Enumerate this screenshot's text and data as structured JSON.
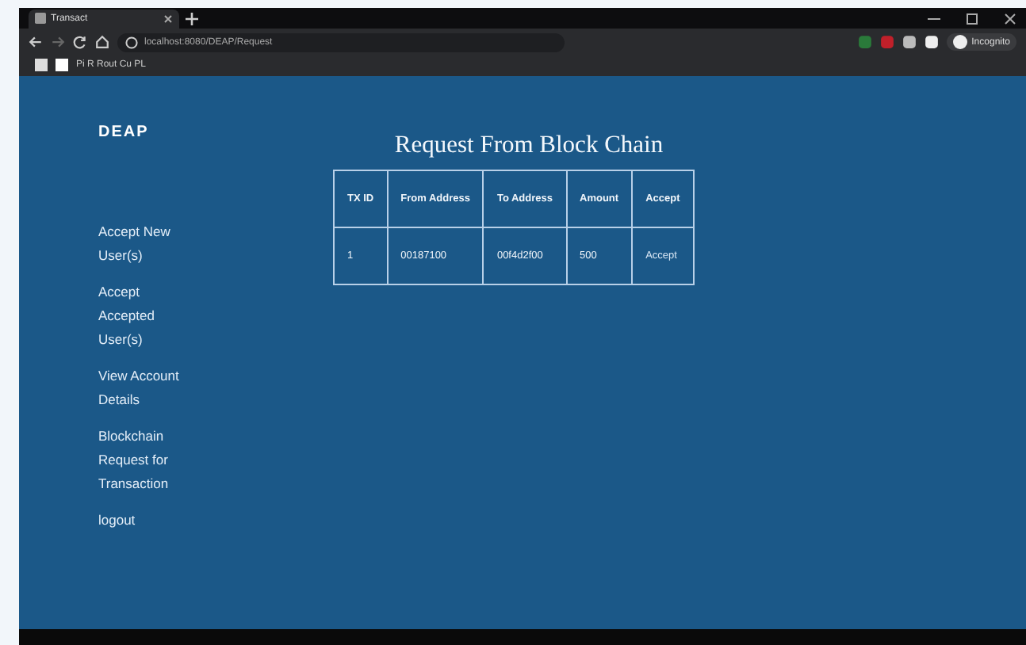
{
  "browser": {
    "tab_title": "Transact",
    "url": "localhost:8080/DEAP/Request",
    "bookmark": "Pi R Rout Cu PL",
    "profile": "Incognito"
  },
  "site": {
    "logo": "DEAP"
  },
  "sidebar": {
    "items": [
      {
        "label": "Accept New User(s)"
      },
      {
        "label": "Accept Accepted User(s)"
      },
      {
        "label": "View Account Details"
      },
      {
        "label": "Blockchain Request for Transaction"
      },
      {
        "label": "logout"
      }
    ]
  },
  "title": "Request From Block Chain",
  "table": {
    "columns": [
      "TX ID",
      "From Address",
      "To Address",
      "Amount",
      "Accept"
    ],
    "rows": [
      {
        "cells": [
          "1",
          "00187100",
          "00f4d2f00",
          "500"
        ],
        "action": "Accept"
      }
    ]
  }
}
